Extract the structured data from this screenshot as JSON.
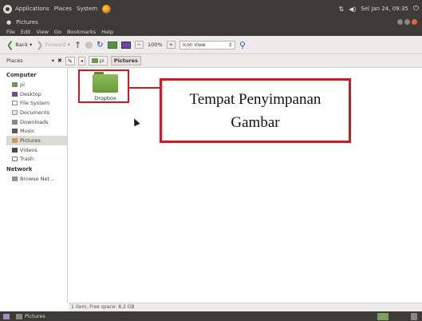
{
  "top_panel": {
    "menus": [
      "Applications",
      "Places",
      "System"
    ],
    "datetime": "Sel Jan 24, 09:35"
  },
  "window": {
    "title": "Pictures"
  },
  "menubar": [
    "File",
    "Edit",
    "View",
    "Go",
    "Bookmarks",
    "Help"
  ],
  "toolbar": {
    "back_label": "Back",
    "forward_label": "Forward",
    "zoom_level": "100%",
    "view_mode": "Icon View"
  },
  "location_bar": {
    "places_label": "Places",
    "crumbs": [
      "pi",
      "Pictures"
    ]
  },
  "sidebar": {
    "computer_heading": "Computer",
    "computer_items": [
      {
        "label": "pi",
        "icon": "home-folder-icon"
      },
      {
        "label": "Desktop",
        "icon": "desktop-icon"
      },
      {
        "label": "File System",
        "icon": "filesystem-icon"
      },
      {
        "label": "Documents",
        "icon": "documents-icon"
      },
      {
        "label": "Downloads",
        "icon": "downloads-icon"
      },
      {
        "label": "Music",
        "icon": "music-icon"
      },
      {
        "label": "Pictures",
        "icon": "pictures-icon"
      },
      {
        "label": "Videos",
        "icon": "videos-icon"
      },
      {
        "label": "Trash",
        "icon": "trash-icon"
      }
    ],
    "network_heading": "Network",
    "network_items": [
      {
        "label": "Browse Net...",
        "icon": "network-icon"
      }
    ]
  },
  "main": {
    "folders": [
      {
        "label": "Dropbox",
        "icon": "folder-icon",
        "color": "#7aab4a"
      }
    ]
  },
  "callout": {
    "line1": "Tempat Penyimpanan",
    "line2": "Gambar",
    "border_color": "#d9161c"
  },
  "statusbar": {
    "text": "1 item, Free space: 8,2 GB"
  },
  "bottom_panel": {
    "task_label": "Pictures"
  }
}
